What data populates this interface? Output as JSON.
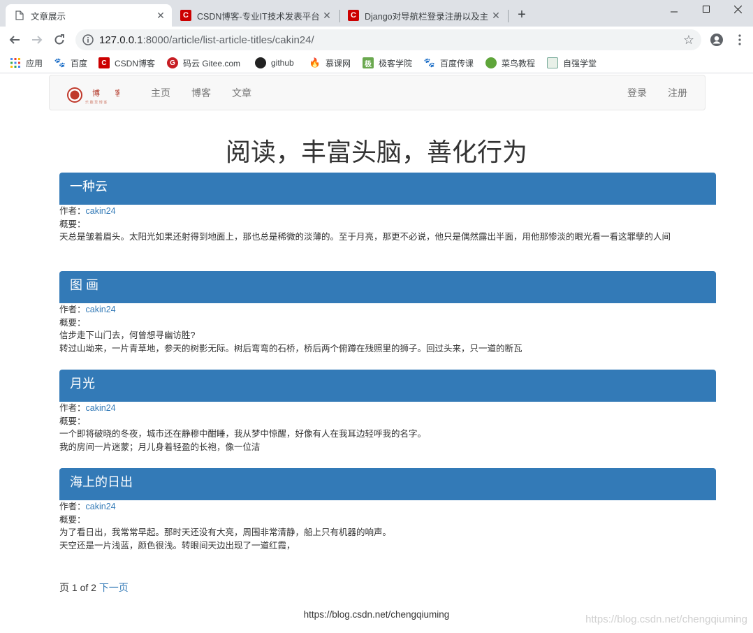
{
  "browser": {
    "tabs": [
      {
        "title": "文章展示",
        "active": true
      },
      {
        "title": "CSDN博客-专业IT技术发表平台",
        "active": false
      },
      {
        "title": "Django对导航栏登录注册以及主",
        "active": false
      }
    ],
    "url_host": "127.0.0.1",
    "url_rest": ":8000/article/list-article-titles/cakin24/",
    "bookmarks": [
      "应用",
      "百度",
      "CSDN博客",
      "码云 Gitee.com",
      "github",
      "慕课网",
      "极客学院",
      "百度传课",
      "菜鸟教程",
      "自强学堂"
    ]
  },
  "nav": {
    "logo_text": "博 客",
    "logo_sub": "乐 趣 至 博 客",
    "links": [
      "主页",
      "博客",
      "文章"
    ],
    "login": "登录",
    "register": "注册"
  },
  "headline": "阅读，丰富头脑，善化行为",
  "labels": {
    "author": "作者：",
    "summary": "概要："
  },
  "articles": [
    {
      "title": "一种云",
      "author": "cakin24",
      "lines": [
        "天总是皱着眉头。太阳光如果还射得到地面上，那也总是稀微的淡薄的。至于月亮，那更不必说，他只是偶然露出半面，用他那惨淡的眼光看一看这罪孽的人间"
      ]
    },
    {
      "title": "图 画",
      "author": "cakin24",
      "lines": [
        "信步走下山门去，何曾想寻幽访胜?",
        "转过山坳来，一片青草地，参天的树影无际。树后弯弯的石桥，桥后两个俯蹲在残照里的狮子。回过头来，只一道的断瓦"
      ]
    },
    {
      "title": "月光",
      "author": "cakin24",
      "lines": [
        "一个即将破晓的冬夜，城市还在静穆中酣睡，我从梦中惊醒，好像有人在我耳边轻呼我的名字。",
        "我的房间一片迷蒙；月儿身着轻盈的长袍，像一位洁"
      ]
    },
    {
      "title": "海上的日出",
      "author": "cakin24",
      "lines": [
        "为了看日出，我常常早起。那时天还没有大亮，周围非常清静，船上只有机器的响声。",
        "天空还是一片浅蓝，颜色很浅。转眼间天边出现了一道红霞，"
      ]
    }
  ],
  "pager": {
    "prefix": "页 1 of 2",
    "next": "下一页"
  },
  "footer": "https://blog.csdn.net/chengqiuming",
  "watermark": "https://blog.csdn.net/chengqiuming"
}
